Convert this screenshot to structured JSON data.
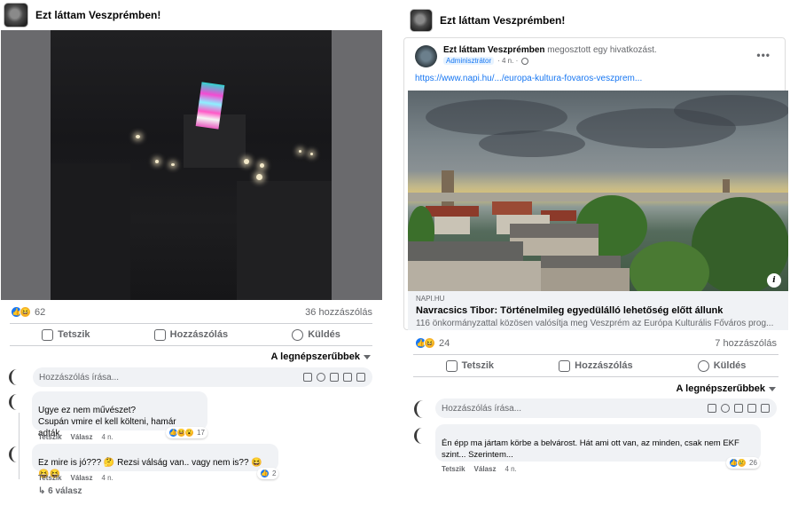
{
  "left_post": {
    "group_name": "Ezt láttam Veszprémben!",
    "reaction_count": "62",
    "comments_count": "36 hozzászólás",
    "actions": {
      "like": "Tetszik",
      "comment": "Hozzászólás",
      "send": "Küldés"
    },
    "sort_label": "A legnépszerűbbek",
    "comment_placeholder": "Hozzászólás írása...",
    "comments": [
      {
        "author": "",
        "line1": "Ugye ez nem művészet?",
        "line2": "Csupán vmire el kell költeni, hamár adták.",
        "like_label": "Tetszik",
        "reply_label": "Válasz",
        "time": "4 n.",
        "reactions": "17"
      },
      {
        "author": "",
        "line1": "Ez mire is jó??? 🤔 Rezsi válság van.. vagy nem is?? 😆😆😆",
        "like_label": "Tetszik",
        "reply_label": "Válasz",
        "time": "4 n.",
        "reactions": "2",
        "more_replies": "↳ 6 válasz"
      }
    ]
  },
  "right_post": {
    "group_name": "Ezt láttam Veszprémben!",
    "page_name": "Ezt láttam Veszprémben",
    "shared_text": "megosztott egy hivatkozást.",
    "admin_badge": "Adminisztrátor",
    "time": "· 4 n. ·",
    "link_url": "https://www.napi.hu/.../europa-kultura-fovaros-veszprem...",
    "link_domain": "NAPI.HU",
    "link_title": "Navracsics Tibor: Történelmileg egyedülálló lehetőség előtt állunk",
    "link_desc": "116 önkormányzattal közösen valósítja meg Veszprém az Európa Kulturális Főváros prog...",
    "reaction_count": "24",
    "comments_count": "7 hozzászólás",
    "actions": {
      "like": "Tetszik",
      "comment": "Hozzászólás",
      "send": "Küldés"
    },
    "sort_label": "A legnépszerűbbek",
    "comment_placeholder": "Hozzászólás írása...",
    "comment": {
      "author": "",
      "line1": "Én épp ma jártam körbe a belvárost. Hát ami ott van, az minden, csak nem EKF",
      "line2": "szint... Szerintem...",
      "like_label": "Tetszik",
      "reply_label": "Válasz",
      "time": "4 n.",
      "reactions": "26"
    }
  },
  "colors": {
    "accent": "#1877f2",
    "muted": "#65676b",
    "bubble": "#f0f2f5"
  },
  "icons": [
    "group-avatar-icon",
    "like-icon",
    "comment-icon",
    "messenger-icon",
    "camera-icon",
    "emoji-icon",
    "gif-icon",
    "sticker-icon",
    "globe-icon",
    "info-icon"
  ]
}
